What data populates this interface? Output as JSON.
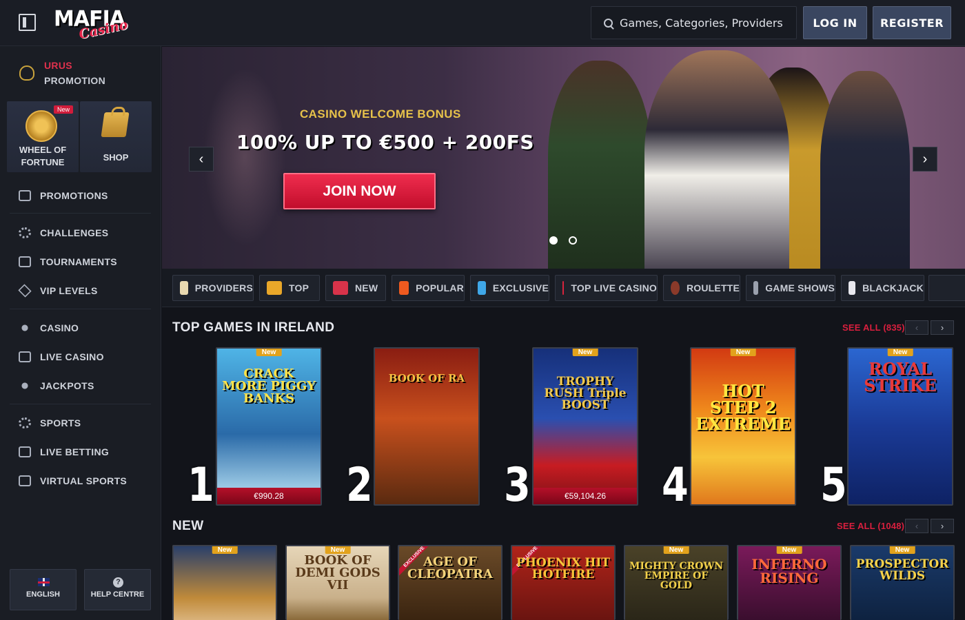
{
  "header": {
    "logo_main": "MAFIA",
    "logo_sub": "Casino",
    "search_placeholder": "Games, Categories, Providers",
    "login_label": "LOG IN",
    "register_label": "REGISTER"
  },
  "sidebar": {
    "promo_title": "URUS",
    "promo_sub": "PROMOTION",
    "tiles": [
      {
        "label": "WHEEL OF FORTUNE",
        "badge": "New"
      },
      {
        "label": "SHOP"
      }
    ],
    "items": [
      {
        "label": "PROMOTIONS",
        "icon": "gift-icon"
      },
      {
        "label": "CHALLENGES",
        "icon": "gear-icon"
      },
      {
        "label": "TOURNAMENTS",
        "icon": "podium-icon"
      },
      {
        "label": "VIP LEVELS",
        "icon": "diamond-icon"
      },
      {
        "label": "CASINO",
        "icon": "spade-icon"
      },
      {
        "label": "LIVE CASINO",
        "icon": "cards-icon"
      },
      {
        "label": "JACKPOTS",
        "icon": "clover-icon"
      },
      {
        "label": "SPORTS",
        "icon": "soccer-ball-icon"
      },
      {
        "label": "LIVE BETTING",
        "icon": "live-icon"
      },
      {
        "label": "VIRTUAL SPORTS",
        "icon": "monitor-ball-icon"
      }
    ],
    "language_label": "ENGLISH",
    "help_label": "HELP CENTRE"
  },
  "hero": {
    "subtitle": "CASINO WELCOME BONUS",
    "title": "100% UP TO €500 + 200FS",
    "cta": "JOIN NOW"
  },
  "categories": [
    {
      "label": "PROVIDERS",
      "icon": "providers-icon",
      "color": "#e9d9b0"
    },
    {
      "label": "TOP",
      "icon": "crown-icon",
      "color": "#e9a729"
    },
    {
      "label": "NEW",
      "icon": "new-flag-icon",
      "color": "#d8334a"
    },
    {
      "label": "POPULAR",
      "icon": "fire-icon",
      "color": "#ef5a1f"
    },
    {
      "label": "EXCLUSIVE",
      "icon": "diamond-icon",
      "color": "#3fa7e8"
    },
    {
      "label": "TOP LIVE CASINO",
      "icon": "chip-icon",
      "color": "#d8233c"
    },
    {
      "label": "ROULETTE",
      "icon": "roulette-icon",
      "color": "#8b3a2a"
    },
    {
      "label": "GAME SHOWS",
      "icon": "microphone-icon",
      "color": "#9aa0ad"
    },
    {
      "label": "BLACKJACK",
      "icon": "cards-icon",
      "color": "#e8e8ee"
    }
  ],
  "top_games": {
    "title": "TOP GAMES IN IRELAND",
    "see_all": "SEE ALL (835)",
    "games": [
      {
        "rank": "1",
        "name": "CRACK MORE PIGGY BANKS",
        "badge": "New",
        "jackpot": "€990.28",
        "bg": "#3fa2d6"
      },
      {
        "rank": "2",
        "name": "BOOK OF RA",
        "badge": "",
        "jackpot": "",
        "bg": "#a8341a"
      },
      {
        "rank": "3",
        "name": "TROPHY RUSH Triple BOOST",
        "badge": "New",
        "jackpot": "€59,104.26",
        "bg": "#1f3a7a"
      },
      {
        "rank": "4",
        "name": "HOT STEP 2 EXTREME",
        "badge": "New",
        "jackpot": "",
        "bg": "#e8741a"
      },
      {
        "rank": "5",
        "name": "ROYAL STRIKE",
        "badge": "New",
        "jackpot": "",
        "bg": "#2a5fc0"
      }
    ]
  },
  "new_games": {
    "title": "NEW",
    "see_all": "SEE ALL (1048)",
    "games": [
      {
        "name": "",
        "badge": "New",
        "excl": "",
        "bg": "#2a3f6a"
      },
      {
        "name": "BOOK OF DEMI GODS VII",
        "badge": "New",
        "excl": "",
        "bg": "#c9b08a"
      },
      {
        "name": "AGE OF CLEOPATRA",
        "badge": "",
        "excl": "EXCLUSIVE",
        "bg": "#5a3a1a"
      },
      {
        "name": "PHOENIX HIT HOTFIRE",
        "badge": "",
        "excl": "EXCLUSIVE",
        "bg": "#8a1f12"
      },
      {
        "name": "MIGHTY CROWN EMPIRE OF GOLD",
        "badge": "New",
        "excl": "",
        "bg": "#3a3520"
      },
      {
        "name": "INFERNO RISING",
        "badge": "New",
        "excl": "",
        "bg": "#6a1a4a"
      },
      {
        "name": "PROSPECTOR WILDS",
        "badge": "New",
        "excl": "",
        "bg": "#1a3a6a"
      }
    ]
  }
}
